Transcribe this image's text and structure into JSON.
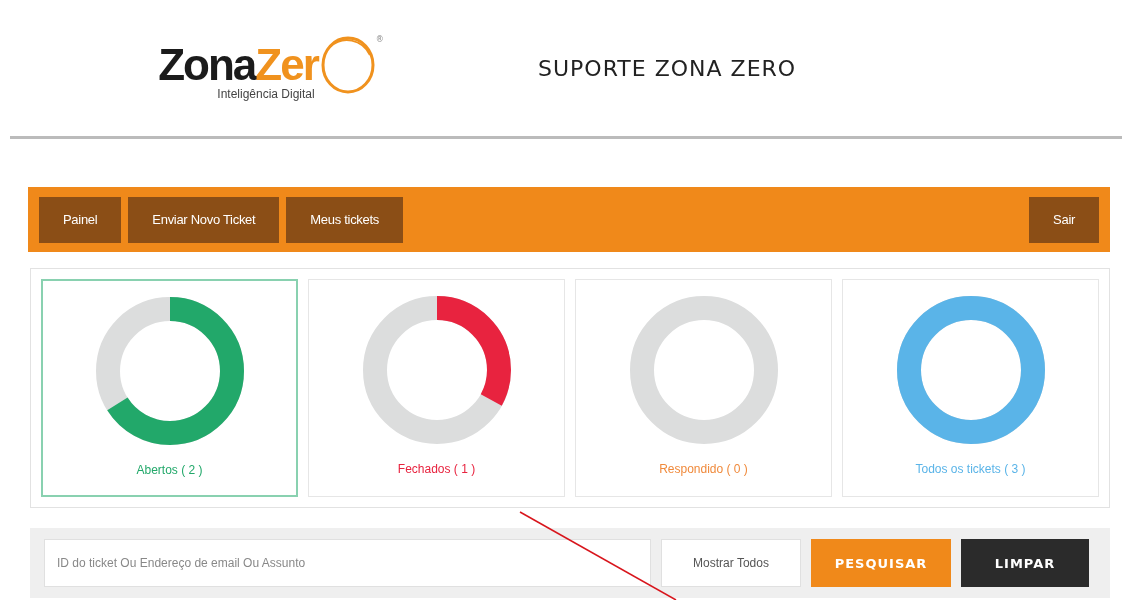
{
  "header": {
    "logo": {
      "wordmark_dark": "Zona",
      "wordmark_orange": "Zer",
      "mark": "®",
      "tagline": "Inteligência Digital"
    },
    "title": "SUPORTE ZONA ZERO"
  },
  "nav": {
    "left": [
      "Painel",
      "Enviar Novo Ticket",
      "Meus tickets"
    ],
    "right": "Sair"
  },
  "stats": [
    {
      "label": "Abertos ( 2 )",
      "level": 0.66,
      "color": "#22a86a",
      "selected": true
    },
    {
      "label": "Fechados ( 1 )",
      "level": 0.33,
      "color": "#e8233f",
      "selected": false
    },
    {
      "label": "Respondido ( 0 )",
      "level": 0,
      "color": "#f08a3c",
      "selected": false
    },
    {
      "label": "Todos os tickets ( 3 )",
      "level": 1,
      "color": "#5ab4e8",
      "selected": false
    }
  ],
  "search": {
    "placeholder": "ID do ticket Ou Endereço de email Ou Assunto",
    "show_all": "Mostrar Todos",
    "search_button": "PESQUISAR",
    "clear_button": "LIMPAR"
  }
}
